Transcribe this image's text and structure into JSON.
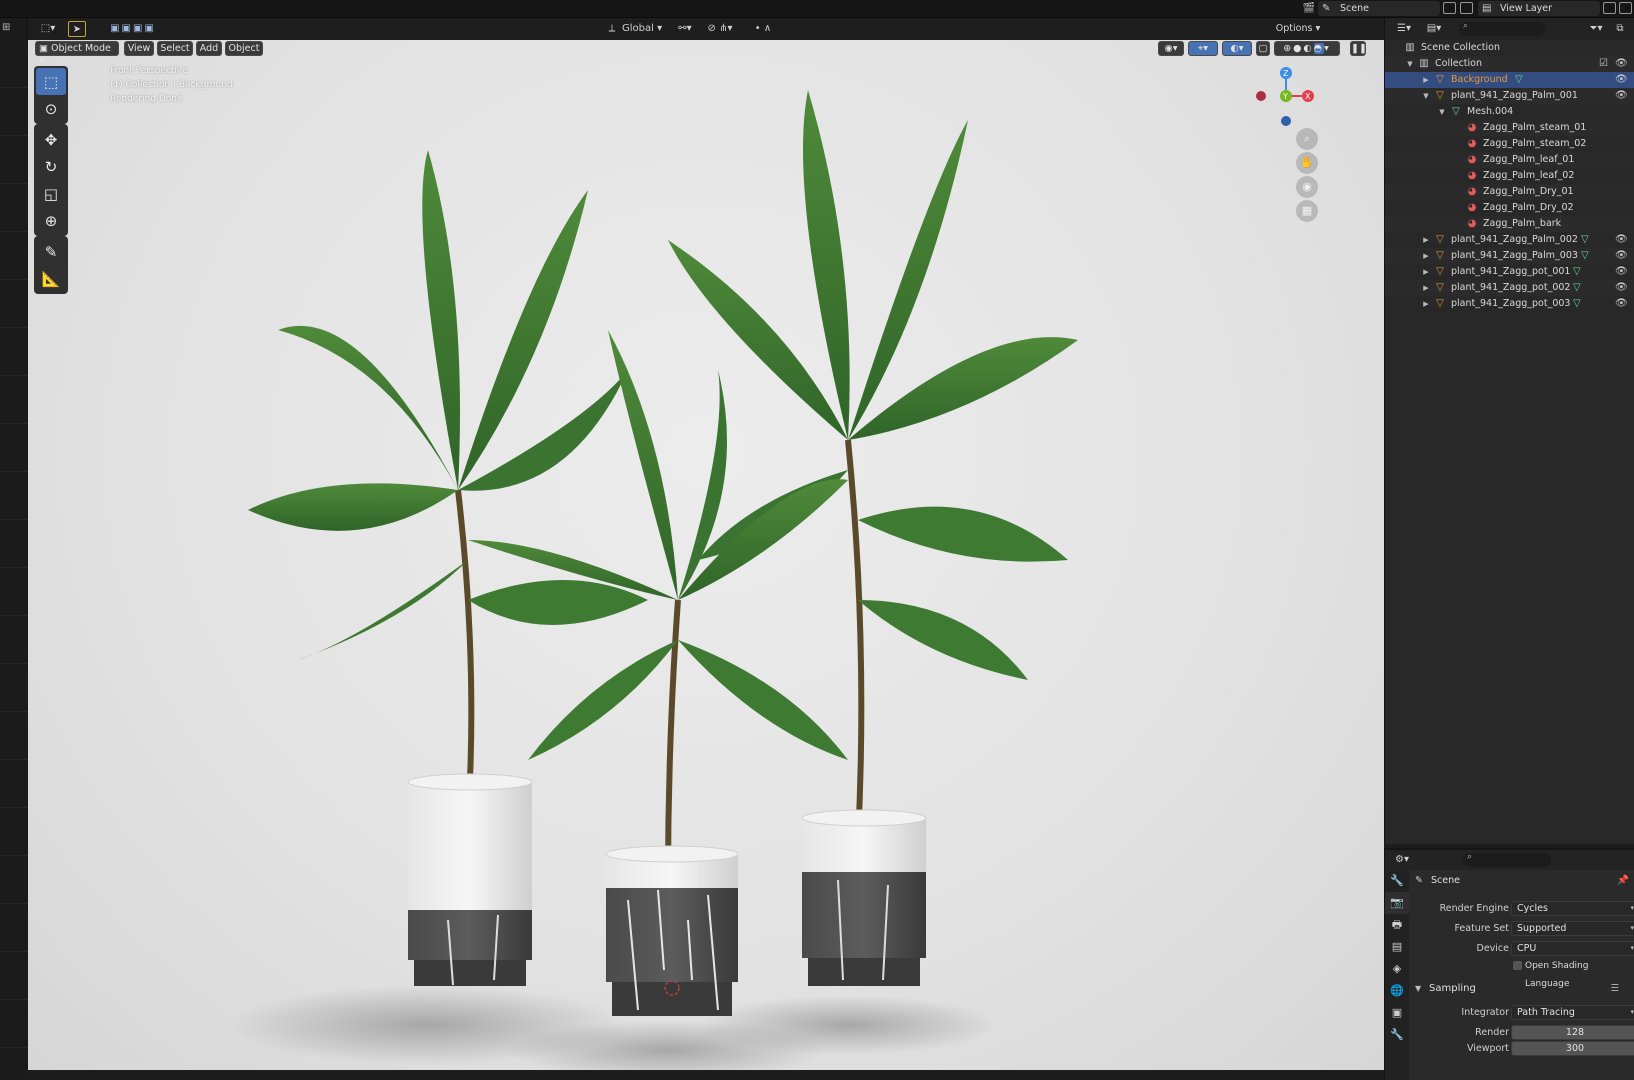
{
  "topbar": {
    "scene_label": "Scene",
    "view_layer_label": "View Layer"
  },
  "viewport_header": {
    "transform_orientation": "Global",
    "options_label": "Options"
  },
  "viewport_menu": {
    "mode": "Object Mode",
    "view": "View",
    "select": "Select",
    "add": "Add",
    "object": "Object"
  },
  "overlay": {
    "line1": "Front Perspective",
    "line2": "(1) Collection | Background",
    "line3": "Rendering Done"
  },
  "gizmo": {
    "z": "Z",
    "y": "Y",
    "x": "X"
  },
  "outliner": {
    "root": "Scene Collection",
    "collection": "Collection",
    "items": [
      {
        "label": "Background",
        "selected": true
      },
      {
        "label": "plant_941_Zagg_Palm_001"
      },
      {
        "label": "Mesh.004"
      },
      {
        "label": "Zagg_Palm_steam_01"
      },
      {
        "label": "Zagg_Palm_steam_02"
      },
      {
        "label": "Zagg_Palm_leaf_01"
      },
      {
        "label": "Zagg_Palm_leaf_02"
      },
      {
        "label": "Zagg_Palm_Dry_01"
      },
      {
        "label": "Zagg_Palm_Dry_02"
      },
      {
        "label": "Zagg_Palm_bark"
      },
      {
        "label": "plant_941_Zagg_Palm_002"
      },
      {
        "label": "plant_941_Zagg_Palm_003"
      },
      {
        "label": "plant_941_Zagg_pot_001"
      },
      {
        "label": "plant_941_Zagg_pot_002"
      },
      {
        "label": "plant_941_Zagg_pot_003"
      }
    ]
  },
  "properties": {
    "context": "Scene",
    "render_engine_label": "Render Engine",
    "render_engine_value": "Cycles",
    "feature_set_label": "Feature Set",
    "feature_set_value": "Supported",
    "device_label": "Device",
    "device_value": "CPU",
    "osl_label": "Open Shading Language",
    "sampling_label": "Sampling",
    "integrator_label": "Integrator",
    "integrator_value": "Path Tracing",
    "render_label": "Render",
    "render_value": "128",
    "viewport_label": "Viewport",
    "viewport_value": "300"
  },
  "colors": {
    "selection_blue": "#4772b3",
    "outliner_selected": "#334d80",
    "object_orange": "#e8963a",
    "axis_x": "#e04050",
    "axis_y": "#7ab820",
    "axis_z": "#3c8ce8"
  }
}
